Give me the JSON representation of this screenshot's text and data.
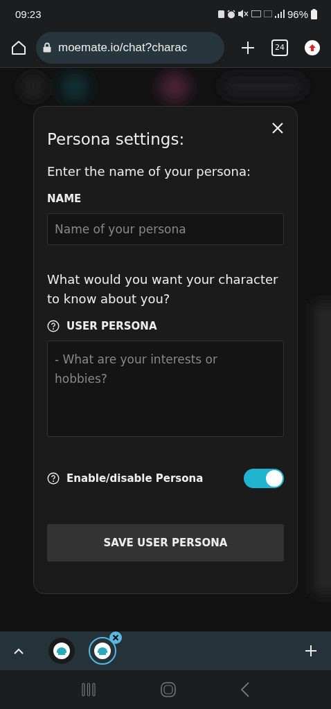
{
  "status_bar": {
    "time": "09:23",
    "battery": "96%"
  },
  "browser": {
    "url": "moemate.io/chat?charac",
    "tab_count": "24"
  },
  "modal": {
    "title": "Persona settings:",
    "prompt": "Enter the name of your persona:",
    "name_label": "NAME",
    "name_placeholder": "Name of your persona",
    "question": "What would you want your character to know about you?",
    "persona_label": "USER PERSONA",
    "persona_placeholder": "- What are your interests or hobbies?",
    "toggle": {
      "label": "Enable/disable Persona",
      "on": true
    },
    "save_button": "SAVE USER PERSONA"
  },
  "tab_strip": {
    "tabs": [
      {
        "selected": false
      },
      {
        "selected": true
      }
    ]
  }
}
